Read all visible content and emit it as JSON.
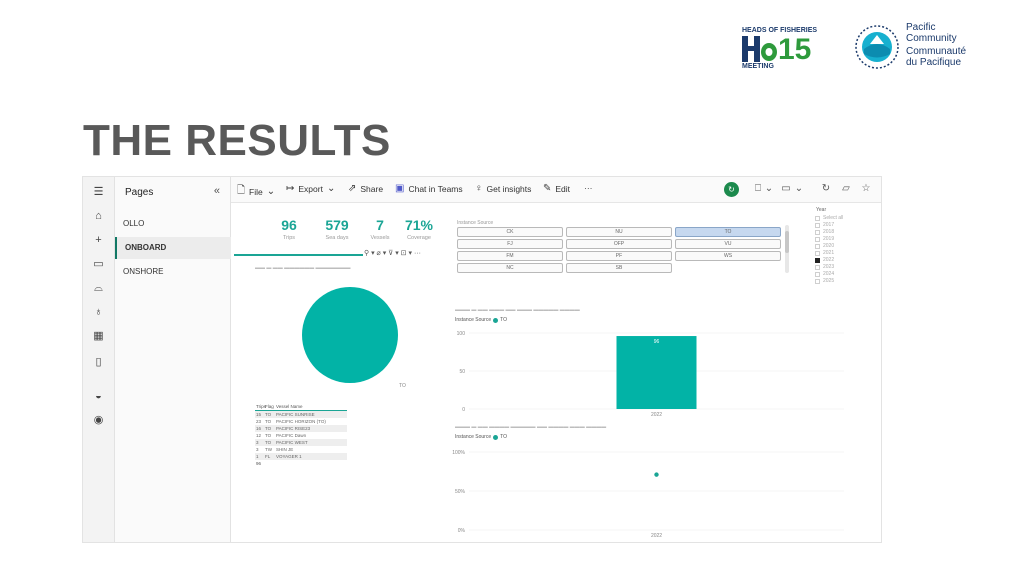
{
  "slide": {
    "title": "THE RESULTS"
  },
  "logos": {
    "hof": {
      "top_text": "HEADS OF FISHERIES",
      "number": "15",
      "bottom_text": "MEETING"
    },
    "spc": {
      "line1": "Pacific",
      "line2": "Community",
      "line3": "Communauté",
      "line4": "du Pacifique"
    }
  },
  "app": {
    "pages_panel": {
      "title": "Pages",
      "items": [
        {
          "label": "OLLO"
        },
        {
          "label": "ONBOARD"
        },
        {
          "label": "ONSHORE"
        }
      ]
    },
    "toolbar": {
      "file": "File",
      "export": "Export",
      "share": "Share",
      "chat": "Chat in Teams",
      "insights": "Get insights",
      "edit": "Edit",
      "more": "···"
    },
    "kpis": [
      {
        "value": "96",
        "label": "Trips"
      },
      {
        "value": "579",
        "label": "Sea days"
      },
      {
        "value": "7",
        "label": "Vessels"
      },
      {
        "value": "71%",
        "label": "Coverage"
      }
    ],
    "slicer": {
      "title": "Instance Source",
      "buttons": [
        [
          "CK",
          "NU",
          "TO"
        ],
        [
          "FJ",
          "OFP",
          "VU"
        ],
        [
          "FM",
          "PF",
          "WS"
        ],
        [
          "NC",
          "SB",
          ""
        ]
      ],
      "selected": "TO"
    },
    "year_filter": {
      "title": "Year",
      "items": [
        {
          "label": "Select all",
          "checked": false
        },
        {
          "label": "2017",
          "checked": false
        },
        {
          "label": "2018",
          "checked": false
        },
        {
          "label": "2019",
          "checked": false
        },
        {
          "label": "2020",
          "checked": false
        },
        {
          "label": "2021",
          "checked": false
        },
        {
          "label": "2022",
          "checked": true
        },
        {
          "label": "2023",
          "checked": false
        },
        {
          "label": "2024",
          "checked": false
        },
        {
          "label": "2025",
          "checked": false
        }
      ]
    },
    "pie_label": "TO",
    "table": {
      "headers": [
        "Trips",
        "Flag",
        "Vessel Name"
      ],
      "rows": [
        [
          "15",
          "TO",
          "PACIFIC SUNRISE"
        ],
        [
          "23",
          "TO",
          "PACIFIC HORIZON (TO)"
        ],
        [
          "16",
          "TO",
          "PACIFIC RISE23"
        ],
        [
          "12",
          "TO",
          "PACIFIC Dawn"
        ],
        [
          "3",
          "TO",
          "PACIFIC WEST"
        ],
        [
          "3",
          "TW",
          "SHIN JE"
        ],
        [
          "1",
          "FL",
          "VOYAGER 1"
        ]
      ],
      "total": "96"
    },
    "legend_label": "TO",
    "legend_title": "Instance Source"
  },
  "chart_data": [
    {
      "type": "bar",
      "categories": [
        "2022"
      ],
      "series": [
        {
          "name": "TO",
          "values": [
            96
          ]
        }
      ],
      "ylim": [
        0,
        100
      ],
      "yticks": [
        "0",
        "50",
        "100"
      ],
      "data_labels": [
        "96"
      ],
      "grid": true,
      "legend": "top-left"
    },
    {
      "type": "scatter",
      "x": [
        "2022"
      ],
      "series": [
        {
          "name": "TO",
          "values": [
            71
          ]
        }
      ],
      "ylim": [
        0,
        100
      ],
      "yticks": [
        "0%",
        "50%",
        "100%"
      ],
      "grid": true,
      "legend": "top-left"
    }
  ],
  "colors": {
    "accent": "#1aa595",
    "pie": "#02b3a6",
    "bar": "#02b3a6",
    "slicer_selected": "#c6d8ef",
    "title_gray": "#595959"
  }
}
